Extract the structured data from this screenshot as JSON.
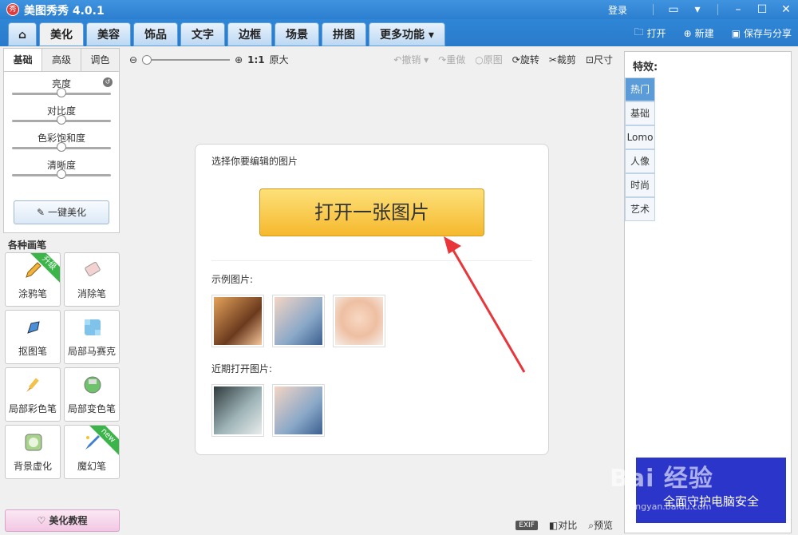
{
  "window": {
    "title": "美图秀秀 4.0.1",
    "login": "登录"
  },
  "tabs": [
    {
      "label": "美化",
      "active": true
    },
    {
      "label": "美容"
    },
    {
      "label": "饰品"
    },
    {
      "label": "文字"
    },
    {
      "label": "边框"
    },
    {
      "label": "场景"
    },
    {
      "label": "拼图"
    },
    {
      "label": "更多功能"
    }
  ],
  "nav_actions": {
    "open": "打开",
    "new": "新建",
    "save": "保存与分享"
  },
  "adjust": {
    "tabs": [
      "基础",
      "高级",
      "调色"
    ],
    "sliders": [
      {
        "label": "亮度",
        "value": 0.5
      },
      {
        "label": "对比度",
        "value": 0.5
      },
      {
        "label": "色彩饱和度",
        "value": 0.5
      },
      {
        "label": "清晰度",
        "value": 0.5
      }
    ],
    "onekey": "一键美化"
  },
  "brushes": {
    "title": "各种画笔",
    "items": [
      {
        "label": "涂鸦笔",
        "badge": "升级"
      },
      {
        "label": "消除笔"
      },
      {
        "label": "抠图笔"
      },
      {
        "label": "局部马赛克"
      },
      {
        "label": "局部彩色笔"
      },
      {
        "label": "局部变色笔"
      },
      {
        "label": "背景虚化"
      },
      {
        "label": "魔幻笔",
        "badge": "new"
      }
    ]
  },
  "tutorial": "美化教程",
  "toolbar": {
    "zoom_ratio": "1:1",
    "original_size": "原大",
    "undo": "撤销",
    "redo": "重做",
    "original": "原图",
    "rotate": "旋转",
    "crop": "裁剪",
    "size": "尺寸"
  },
  "card": {
    "title": "选择你要编辑的图片",
    "open_button": "打开一张图片",
    "sample_label": "示例图片:",
    "recent_label": "近期打开图片:"
  },
  "status": {
    "exif": "EXIF",
    "compare": "对比",
    "preview": "预览"
  },
  "effects": {
    "title": "特效:",
    "tabs": [
      "热门",
      "基础",
      "Lomo",
      "人像",
      "时尚",
      "艺术"
    ]
  },
  "ad": {
    "text": "全面守护电脑安全"
  },
  "watermark": {
    "brand": "Bai 经验",
    "url": "jingyan.baidu.com"
  },
  "colors": {
    "accent": "#2e7fcf",
    "button": "#f5b92d",
    "arrow": "#e8363b"
  }
}
